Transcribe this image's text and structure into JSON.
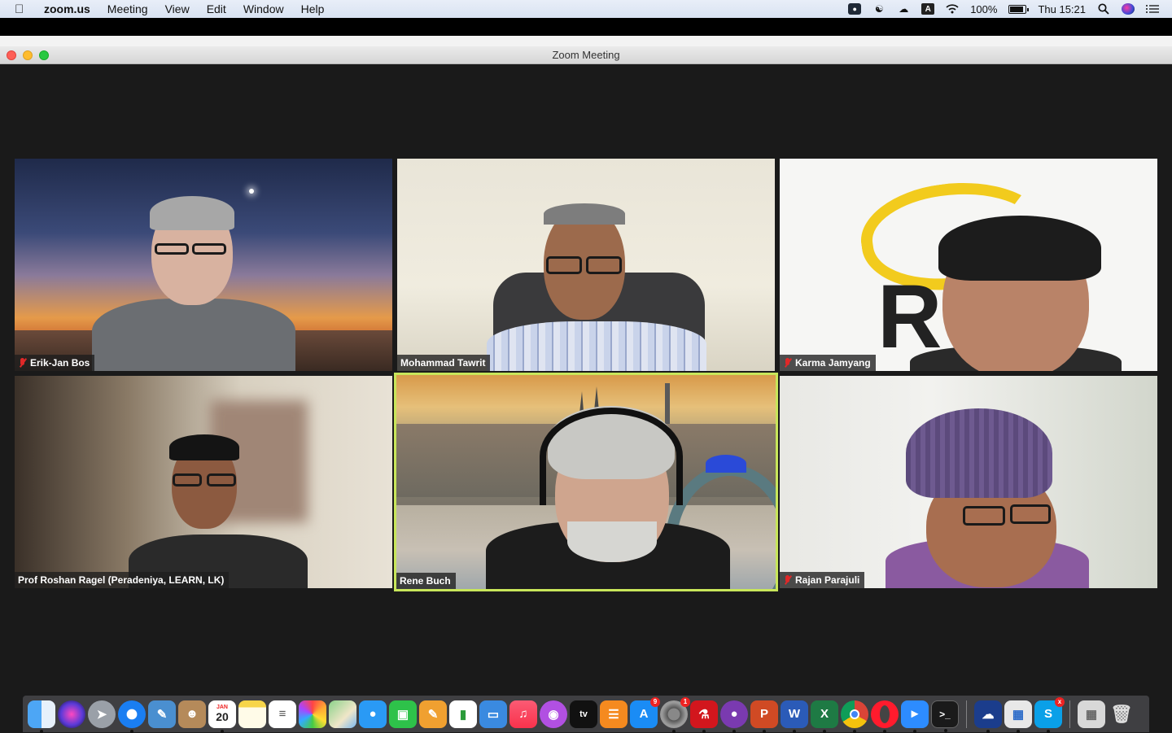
{
  "menubar": {
    "app_name": "zoom.us",
    "menus": [
      "Meeting",
      "View",
      "Edit",
      "Window",
      "Help"
    ],
    "battery": "100%",
    "clock": "Thu 15:21",
    "keyboard_layout": "A"
  },
  "window": {
    "title": "Zoom Meeting"
  },
  "participants": [
    {
      "name": "Erik-Jan Bos",
      "muted": true
    },
    {
      "name": "Mohammad Tawrit",
      "muted": false
    },
    {
      "name": "Karma Jamyang",
      "muted": true
    },
    {
      "name": "Prof Roshan Ragel (Peradeniya, LEARN, LK)",
      "muted": false
    },
    {
      "name": "Rene Buch",
      "muted": false,
      "active_speaker": true
    },
    {
      "name": "Rajan Parajuli",
      "muted": true
    }
  ],
  "tile3_bg_text": "R",
  "dock": {
    "calendar_month": "JAN",
    "calendar_day": "20",
    "appletv_label": "tv",
    "badges": {
      "app_store": "9",
      "system_prefs": "1"
    },
    "items": [
      "finder",
      "siri",
      "launchpad",
      "safari",
      "preview",
      "contacts",
      "calendar",
      "notes",
      "reminders",
      "photos",
      "maps",
      "messages",
      "facetime",
      "pages",
      "numbers",
      "keynote",
      "music",
      "podcasts",
      "appletv",
      "books",
      "app-store",
      "system-preferences",
      "acrobat",
      "tor",
      "powerpoint",
      "word",
      "excel",
      "chrome",
      "opera",
      "zoom",
      "terminal",
      "cloud",
      "vpn",
      "skype",
      "archive",
      "trash"
    ]
  },
  "colors": {
    "active_speaker_border": "#c8e65a",
    "mute_red": "#e02828"
  }
}
